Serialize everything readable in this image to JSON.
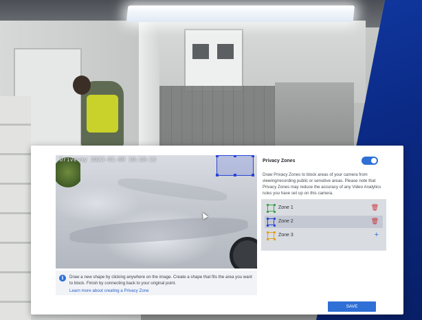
{
  "preview": {
    "timestamp": "Driveway  2023-01-09 10:18:13"
  },
  "info": {
    "text": "Draw a new shape by clicking anywhere on the image. Create a shape that fits the area you want to block. Finish by connecting back to your original point.",
    "link": "Learn more about creating a Privacy Zone"
  },
  "privacy": {
    "title": "Privacy Zones",
    "toggle_on": true,
    "description": "Draw Privacy Zones to block areas of your camera from viewing/recording public or sensitive areas. Please note that Privacy Zones may reduce the accuracy of any Video Analytics rules you have set up on this camera."
  },
  "zones": [
    {
      "label": "Zone 1",
      "icon": "zone-shape-icon",
      "color": "#3fa34d",
      "action": "delete-icon",
      "selected": false
    },
    {
      "label": "Zone 2",
      "icon": "zone-shape-icon",
      "color": "#2845d6",
      "action": "delete-icon",
      "selected": true
    },
    {
      "label": "Zone 3",
      "icon": "zone-shape-icon",
      "color": "#e0a11b",
      "action": "add-icon",
      "selected": false
    }
  ],
  "buttons": {
    "save": "SAVE"
  },
  "colors": {
    "accent": "#2f6fd6",
    "delete": "#c9343a",
    "zone_outline": "#2845d6"
  }
}
